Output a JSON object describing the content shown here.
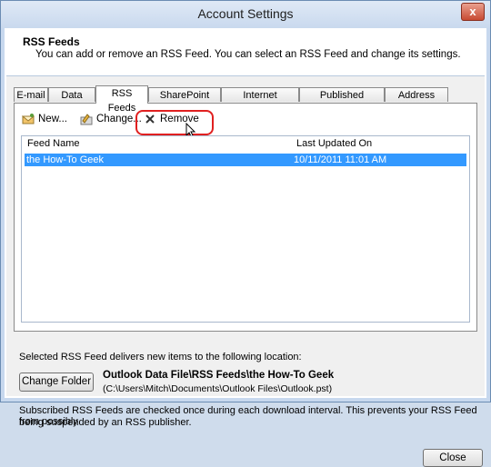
{
  "window": {
    "title": "Account Settings",
    "close_glyph": "x"
  },
  "header": {
    "title": "RSS Feeds",
    "description": "You can add or remove an RSS Feed. You can select an RSS Feed and change its settings."
  },
  "tabs": [
    {
      "label": "E-mail"
    },
    {
      "label": "Data Files"
    },
    {
      "label": "RSS Feeds"
    },
    {
      "label": "SharePoint Lists"
    },
    {
      "label": "Internet Calendars"
    },
    {
      "label": "Published Calendars"
    },
    {
      "label": "Address Books"
    }
  ],
  "active_tab": "RSS Feeds",
  "toolbar": {
    "new_label": "New...",
    "change_label": "Change...",
    "remove_label": "Remove"
  },
  "list": {
    "columns": [
      "Feed Name",
      "Last Updated On"
    ],
    "rows": [
      {
        "name": "the How-To Geek",
        "updated": "10/11/2011 11:01 AM"
      }
    ]
  },
  "location": {
    "label": "Selected RSS Feed delivers new items to the following location:",
    "change_folder_label": "Change Folder",
    "folder": "Outlook Data File\\RSS Feeds\\the How-To Geek",
    "path": "(C:\\Users\\Mitch\\Documents\\Outlook Files\\Outlook.pst)"
  },
  "note": {
    "line1": "Subscribed RSS Feeds are checked once during each download interval. This prevents your RSS Feed from possibly",
    "line2": "being suspended by an RSS publisher."
  },
  "footer": {
    "close_label": "Close"
  },
  "colors": {
    "selection": "#3399ff",
    "highlight_ring": "#e02020"
  }
}
